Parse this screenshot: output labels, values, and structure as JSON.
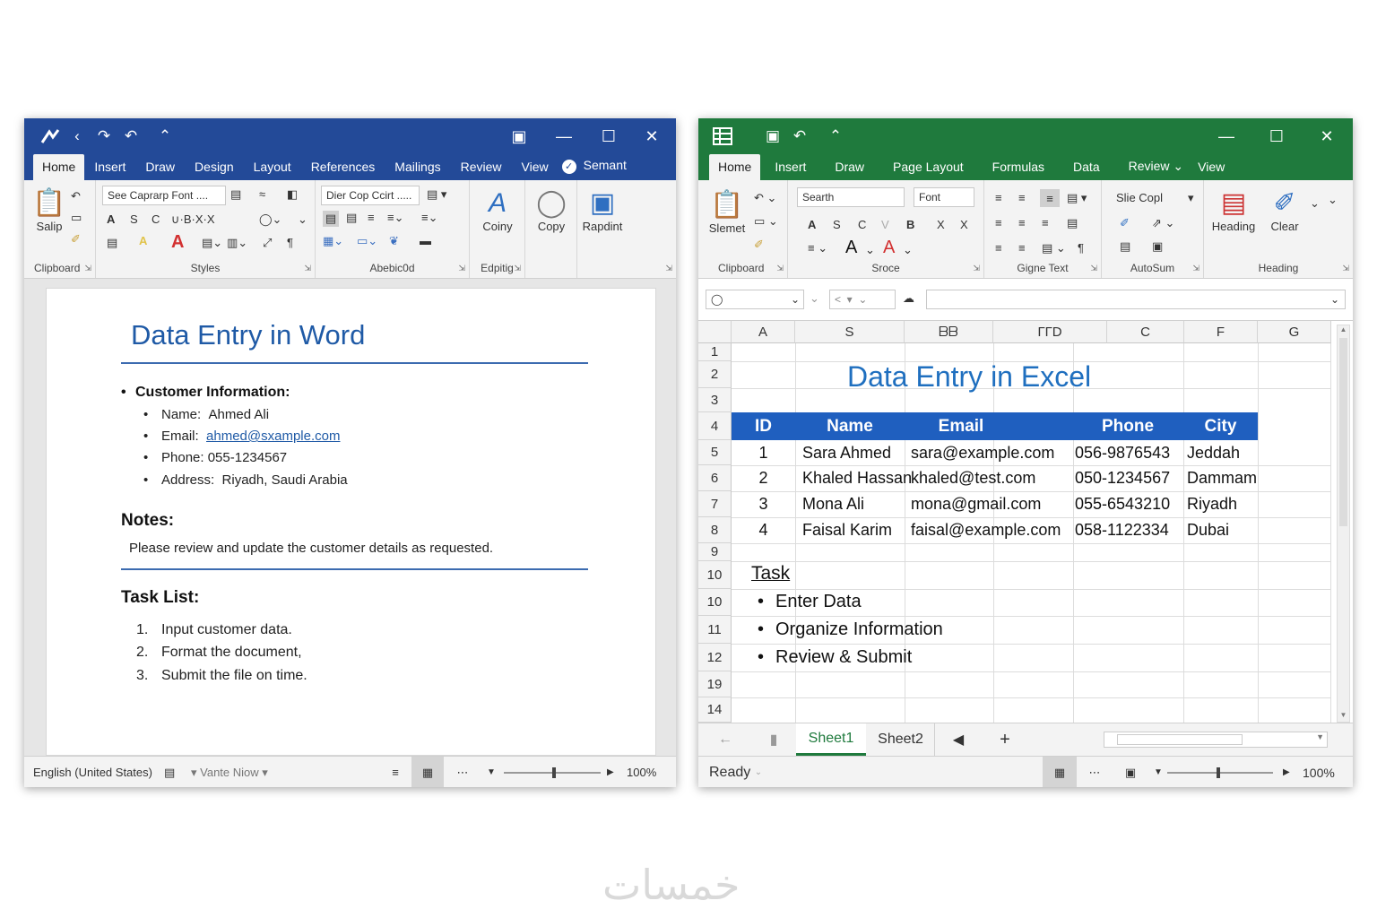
{
  "word": {
    "tabs": [
      "Home",
      "Insert",
      "Draw",
      "Design",
      "Layout",
      "References",
      "Mailings",
      "Review",
      "View",
      "Semant"
    ],
    "ribbon": {
      "paste_label": "Salip",
      "font_box": "See Caprarp  Font ....",
      "styles_box": "Dier Cop  Ccirt  .....",
      "group_clipboard": "Clipboard",
      "group_styles": "Styles",
      "group_abebicdd": "Abebic0d",
      "group_editing": "Edpitig",
      "btn_coby": "Coiny",
      "btn_copy": "Copy",
      "btn_rapding": "Rapdint"
    },
    "doc": {
      "title": "Data Entry in Word",
      "customer_heading": "Customer Information:",
      "name_label": "Name:",
      "name_value": "Ahmed Ali",
      "email_label": "Email:",
      "email_value": "ahmed@sxample.com",
      "phone_label": "Phone:",
      "phone_value": "055-1234567",
      "address_label": "Address:",
      "address_value": "Riyadh, Saudi Arabia",
      "notes_heading": "Notes:",
      "notes_text": "Please review and update the customer details as requested.",
      "task_heading": "Task List:",
      "tasks": [
        "Input customer data.",
        "Format the document,",
        "Submit the file on time."
      ]
    },
    "status": {
      "language": "English (United States)",
      "mode": "Vante  Niow",
      "zoom": "100%"
    }
  },
  "excel": {
    "tabs": [
      "Home",
      "Insert",
      "Draw",
      "Page Layout",
      "Formulas",
      "Data",
      "Review",
      "View"
    ],
    "ribbon": {
      "paste_label": "Slemet",
      "search_box": "Searth",
      "font_box": "Font",
      "style_box": "Slie Copl",
      "group_clipboard": "Clipboard",
      "group_sroce": "Sroce",
      "group_gigne": "Gigne Text",
      "group_autosum": "AutoSum",
      "group_heading": "Heading",
      "btn_heading": "Heading",
      "btn_clear": "Clear"
    },
    "columns": [
      "A",
      "S",
      "ᗷᗷ",
      "ГГD",
      "C",
      "F",
      "G"
    ],
    "rows": [
      "1",
      "2",
      "3",
      "4",
      "5",
      "6",
      "7",
      "8",
      "9",
      "10",
      "10",
      "11",
      "12",
      "19",
      "14"
    ],
    "sheet_title": "Data Entry in Excel",
    "table": {
      "headers": [
        "ID",
        "Name",
        "Email",
        "Phone",
        "City"
      ],
      "rows": [
        [
          "1",
          "Sara Ahmed",
          "sara@example.com",
          "056-9876543",
          "Jeddah"
        ],
        [
          "2",
          "Khaled Hassan",
          "khaled@test.com",
          "050-1234567",
          "Dammam"
        ],
        [
          "3",
          "Mona Ali",
          "mona@gmail.com",
          "055-6543210",
          "Riyadh"
        ],
        [
          "4",
          "Faisal Karim",
          "faisal@example.com",
          "058-1122334",
          "Dubai"
        ]
      ]
    },
    "task_heading": "Task",
    "tasks": [
      "Enter Data",
      "Organize Information",
      "Review & Submit"
    ],
    "sheets": [
      "Sheet1",
      "Sheet2"
    ],
    "status": {
      "ready": "Ready",
      "zoom": "100%"
    }
  },
  "watermark": "خمسات"
}
